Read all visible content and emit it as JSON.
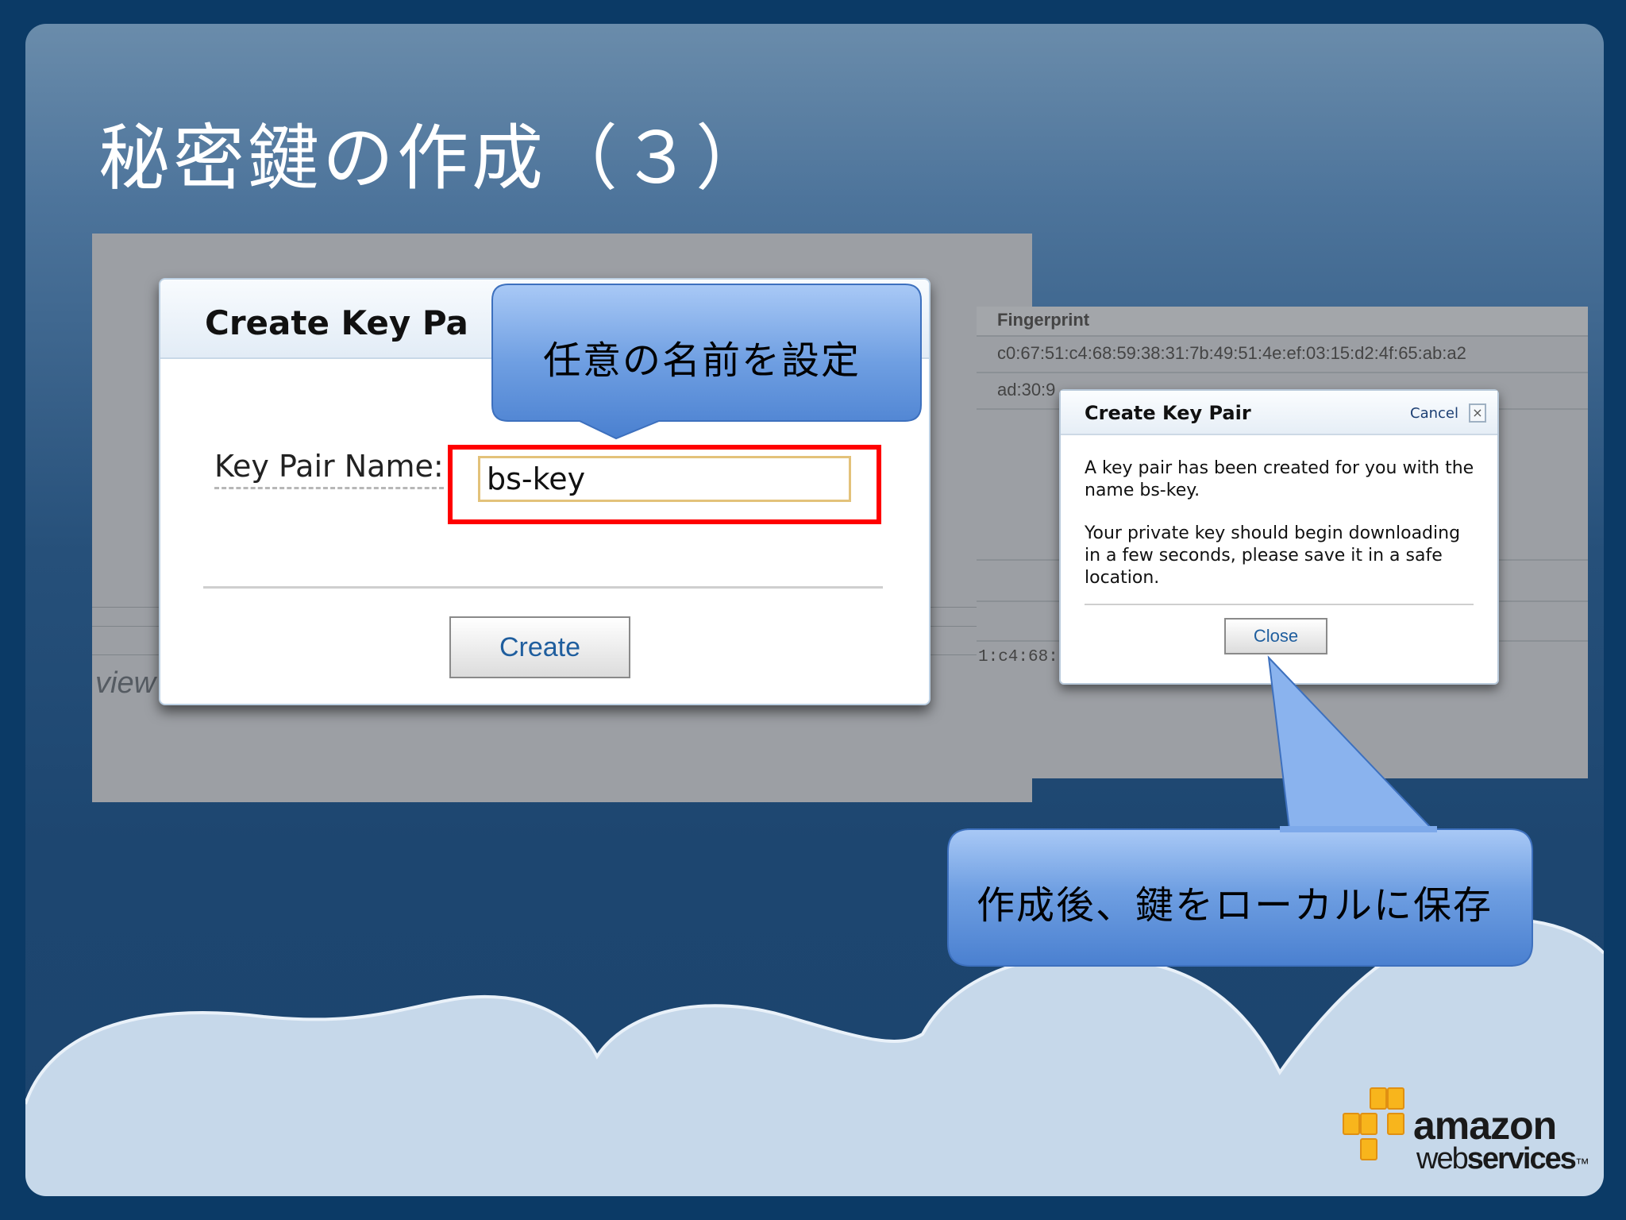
{
  "slide": {
    "title": "秘密鍵の作成（３）"
  },
  "left_dialog": {
    "title": "Create Key Pa",
    "close_glyph": "×",
    "field_label": "Key Pair Name:",
    "field_value": "bs-key",
    "create_label": "Create",
    "background_fragment": "view"
  },
  "callouts": {
    "top": "任意の名前を設定",
    "bottom": "作成後、鍵をローカルに保存"
  },
  "right_panel": {
    "header": "Fingerprint",
    "row1": "c0:67:51:c4:68:59:38:31:7b:49:51:4e:ef:03:15:d2:4f:65:ab:a2",
    "row2": "ad:30:9",
    "side_fragment": "1:c4:68:5"
  },
  "right_dialog": {
    "title": "Create Key Pair",
    "cancel_label": "Cancel",
    "close_glyph": "×",
    "message1": "A key pair has been created for you with the name bs-key.",
    "message2": "Your private key should begin downloading in a few seconds, please save it in a safe location.",
    "close_label": "Close"
  },
  "logo": {
    "word1": "amazon",
    "word2a": "web",
    "word2b": "services",
    "tm": "™",
    "colors": {
      "cubes": "#f8b51c",
      "cubes_dark": "#e09012"
    }
  },
  "colors": {
    "slide_bg": "#26507a",
    "callout_fill": "#5d8fd8",
    "highlight": "#ff0000",
    "cloud": "#cadbec"
  }
}
